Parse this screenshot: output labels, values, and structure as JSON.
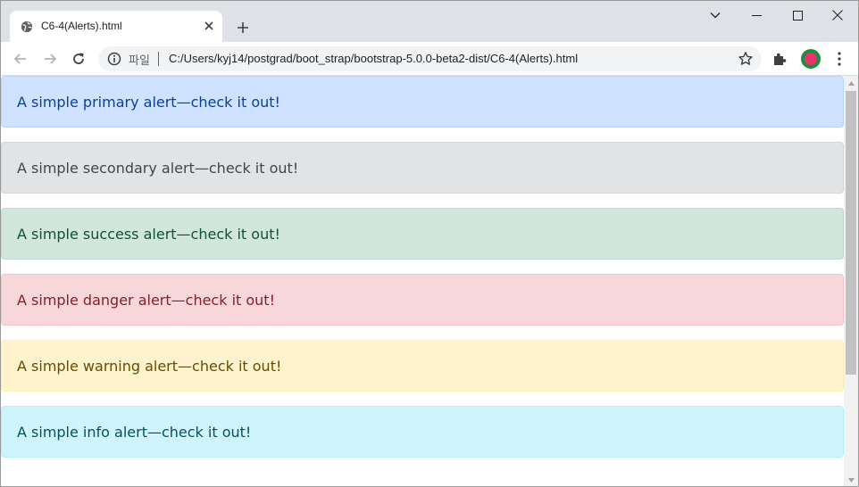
{
  "browser": {
    "tab_title": "C6-4(Alerts).html",
    "url_chip": "파일",
    "url": "C:/Users/kyj14/postgrad/boot_strap/bootstrap-5.0.0-beta2-dist/C6-4(Alerts).html"
  },
  "alerts": [
    {
      "text": "A simple primary alert—check it out!",
      "bg": "#cfe2ff",
      "border": "#b6d4fe",
      "color": "#084298"
    },
    {
      "text": "A simple secondary alert—check it out!",
      "bg": "#e2e3e5",
      "border": "#d3d6d8",
      "color": "#41464b"
    },
    {
      "text": "A simple success alert—check it out!",
      "bg": "#d1e7dd",
      "border": "#badbcc",
      "color": "#0f5132"
    },
    {
      "text": "A simple danger alert—check it out!",
      "bg": "#f8d7da",
      "border": "#f5c2c7",
      "color": "#842029"
    },
    {
      "text": "A simple warning alert—check it out!",
      "bg": "#fff3cd",
      "border": "#ffecb5",
      "color": "#664d03"
    },
    {
      "text": "A simple info alert—check it out!",
      "bg": "#cff4fc",
      "border": "#b6effb",
      "color": "#055160"
    }
  ],
  "icons": {
    "tab": "globe-icon",
    "close": "close-icon",
    "new_tab": "plus-icon",
    "back": "arrow-left-icon",
    "forward": "arrow-right-icon",
    "reload": "reload-icon",
    "info": "info-icon",
    "bookmark": "star-icon",
    "extensions": "puzzle-icon",
    "menu": "kebab-menu-icon"
  }
}
